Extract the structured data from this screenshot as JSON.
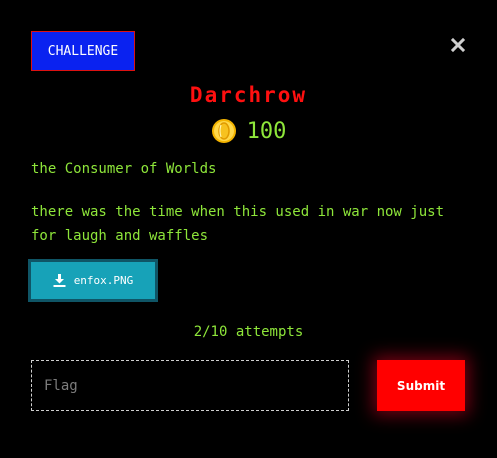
{
  "header": {
    "tab_label": "CHALLENGE",
    "close_icon": "close-icon"
  },
  "challenge": {
    "name": "Darchrow",
    "points": "100",
    "points_icon": "coin-icon",
    "subtitle": "the Consumer of Worlds",
    "description": "there was the time when this used in war now just for laugh and waffles",
    "file": {
      "label": "enfox.PNG",
      "icon": "download-icon"
    },
    "attempts": "2/10 attempts"
  },
  "form": {
    "flag_placeholder": "Flag",
    "flag_value": "",
    "submit_label": "Submit"
  },
  "colors": {
    "background": "#000000",
    "tab_blue": "#0a22f0",
    "title_red": "#ff1010",
    "text_green": "#8ee63a",
    "file_button": "#17a2b8",
    "submit_red": "#ff0000"
  }
}
